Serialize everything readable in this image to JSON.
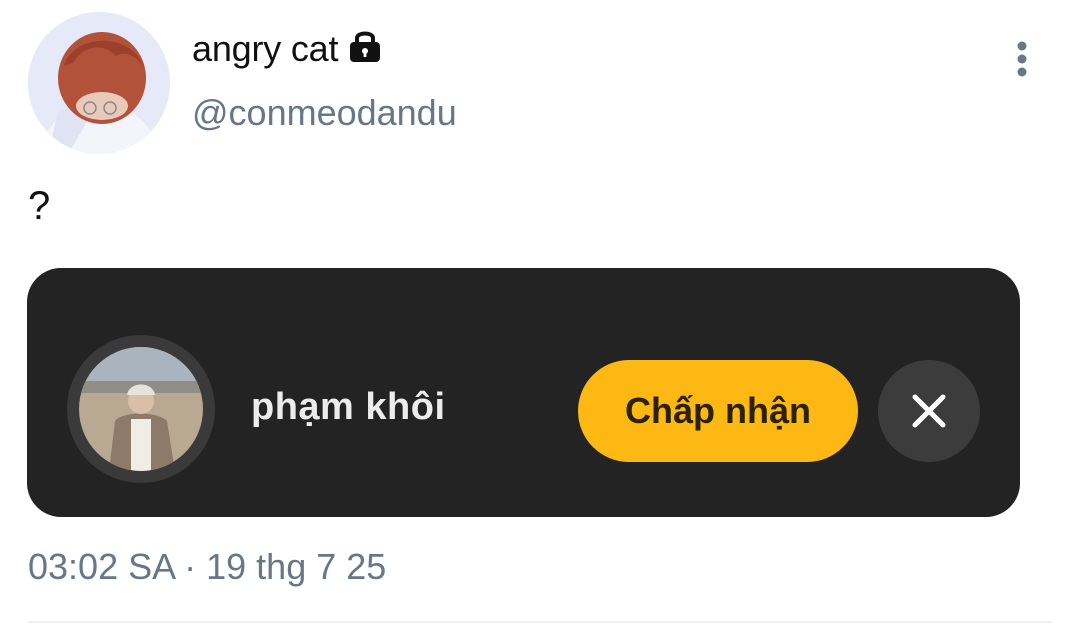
{
  "tweet": {
    "author": {
      "display_name": "angry cat",
      "handle": "@conmeodandu",
      "protected_icon": "lock-icon",
      "avatar": "profile-photo"
    },
    "more_icon": "vertical-ellipsis-icon",
    "text": "?",
    "timestamp": "03:02 SA · 19 thg 7 25"
  },
  "card": {
    "user_name": "phạm  khôi",
    "avatar": "profile-photo",
    "accept_label": "Chấp nhận",
    "dismiss_icon": "close-icon",
    "colors": {
      "background": "#232323",
      "accept": "#fdb813",
      "dismiss": "#3c3c3c"
    }
  }
}
